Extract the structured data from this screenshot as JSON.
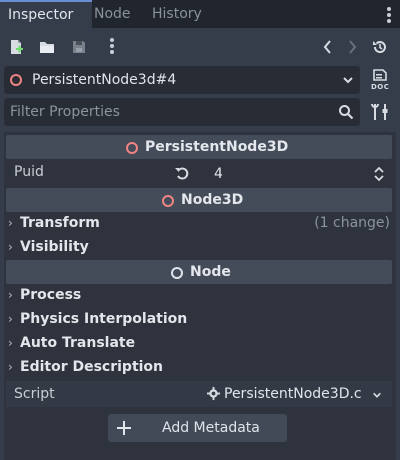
{
  "tabs": [
    {
      "label": "Inspector",
      "active": true
    },
    {
      "label": "Node",
      "active": false
    },
    {
      "label": "History",
      "active": false
    }
  ],
  "toolbar": {
    "icons": [
      "new-resource-icon",
      "load-resource-icon",
      "save-resource-icon",
      "more-options-icon",
      "back-icon",
      "forward-icon",
      "history-icon"
    ]
  },
  "node_selector": {
    "label": "PersistentNode3d#4",
    "doc_label": "DOC"
  },
  "filter": {
    "placeholder": "Filter Properties"
  },
  "sections": {
    "persistent": "PersistentNode3D",
    "node3d": "Node3D",
    "node": "Node"
  },
  "puid": {
    "label": "Puid",
    "value": "4"
  },
  "groups": {
    "transform": "Transform",
    "transform_change": "(1 change)",
    "visibility": "Visibility",
    "process": "Process",
    "physics_interpolation": "Physics Interpolation",
    "auto_translate": "Auto Translate",
    "editor_description": "Editor Description"
  },
  "script": {
    "label": "Script",
    "value": "PersistentNode3D.c"
  },
  "add_metadata": {
    "label": "Add Metadata"
  },
  "colors": {
    "accent": "#6b8fd4",
    "node3d_icon": "#f08383",
    "node_icon": "#dfe3ea"
  }
}
